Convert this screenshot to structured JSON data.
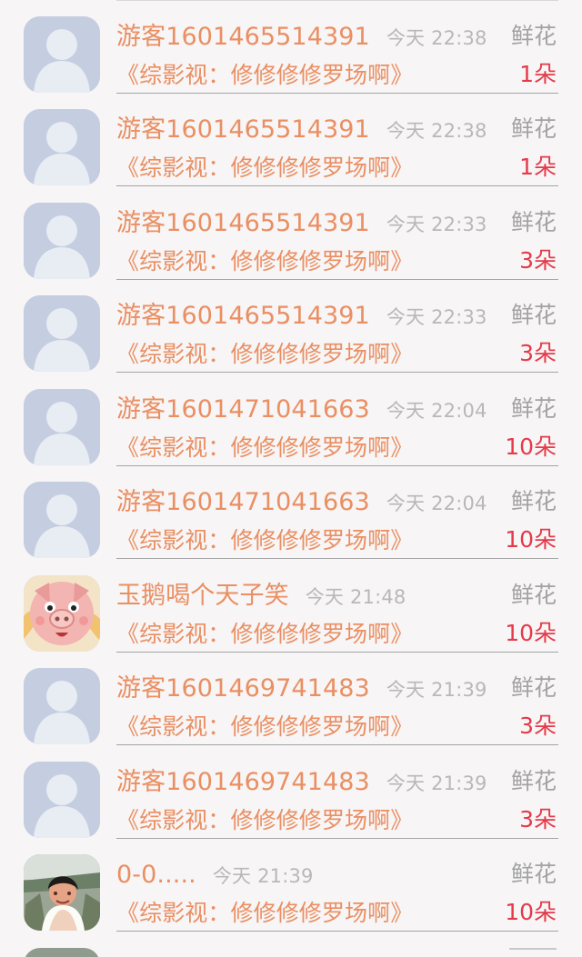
{
  "list": {
    "items": [
      {
        "username": "游客1601465514391",
        "time": "今天 22:38",
        "gift_label": "鲜花",
        "book_title": "《综影视：修修修修罗场啊》",
        "gift_count": "1朵",
        "avatar_icon": "default-user-icon"
      },
      {
        "username": "游客1601465514391",
        "time": "今天 22:38",
        "gift_label": "鲜花",
        "book_title": "《综影视：修修修修罗场啊》",
        "gift_count": "1朵",
        "avatar_icon": "default-user-icon"
      },
      {
        "username": "游客1601465514391",
        "time": "今天 22:33",
        "gift_label": "鲜花",
        "book_title": "《综影视：修修修修罗场啊》",
        "gift_count": "3朵",
        "avatar_icon": "default-user-icon"
      },
      {
        "username": "游客1601465514391",
        "time": "今天 22:33",
        "gift_label": "鲜花",
        "book_title": "《综影视：修修修修罗场啊》",
        "gift_count": "3朵",
        "avatar_icon": "default-user-icon"
      },
      {
        "username": "游客1601471041663",
        "time": "今天 22:04",
        "gift_label": "鲜花",
        "book_title": "《综影视：修修修修罗场啊》",
        "gift_count": "10朵",
        "avatar_icon": "default-user-icon"
      },
      {
        "username": "游客1601471041663",
        "time": "今天 22:04",
        "gift_label": "鲜花",
        "book_title": "《综影视：修修修修罗场啊》",
        "gift_count": "10朵",
        "avatar_icon": "default-user-icon"
      },
      {
        "username": "玉鹅喝个天子笑",
        "time": "今天 21:48",
        "gift_label": "鲜花",
        "book_title": "《综影视：修修修修罗场啊》",
        "gift_count": "10朵",
        "avatar_icon": "cartoon-pig-avatar-icon"
      },
      {
        "username": "游客1601469741483",
        "time": "今天 21:39",
        "gift_label": "鲜花",
        "book_title": "《综影视：修修修修罗场啊》",
        "gift_count": "3朵",
        "avatar_icon": "default-user-icon"
      },
      {
        "username": "游客1601469741483",
        "time": "今天 21:39",
        "gift_label": "鲜花",
        "book_title": "《综影视：修修修修罗场啊》",
        "gift_count": "3朵",
        "avatar_icon": "default-user-icon"
      },
      {
        "username": "0-0.....",
        "time": "今天 21:39",
        "gift_label": "鲜花",
        "book_title": "《综影视：修修修修罗场啊》",
        "gift_count": "10朵",
        "avatar_icon": "photo-avatar-icon"
      }
    ]
  },
  "colors": {
    "background": "#f7f5f5",
    "name_and_title": "#ea8f63",
    "timestamp": "#b8b8b8",
    "gift_label": "#a3a3a3",
    "gift_count": "#e43a4a",
    "divider": "#a5a5a5"
  }
}
